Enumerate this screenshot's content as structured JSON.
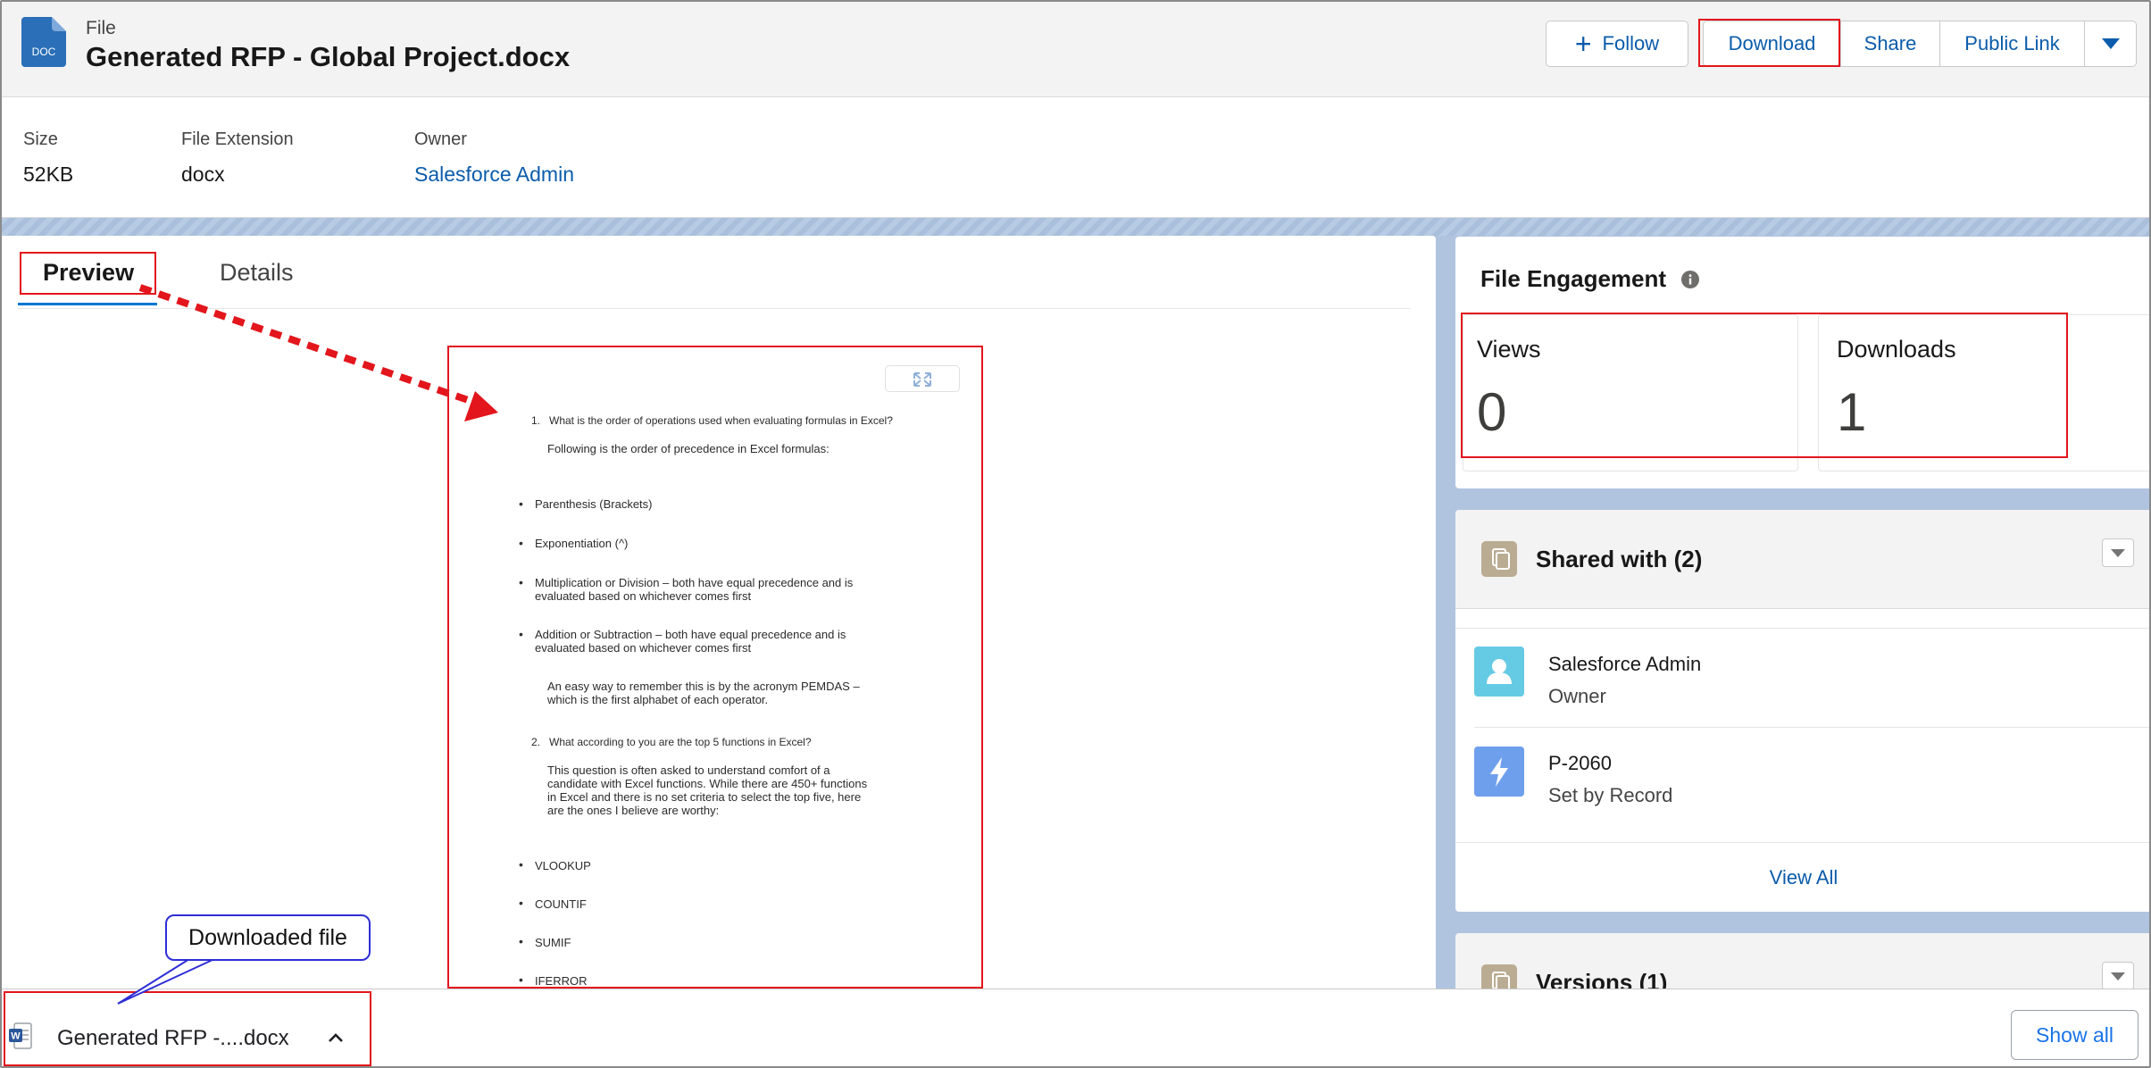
{
  "header": {
    "kind_label": "File",
    "title": "Generated RFP - Global Project.docx",
    "icon_text": "DOC",
    "actions": {
      "follow": "Follow",
      "download": "Download",
      "share": "Share",
      "public_link": "Public Link"
    }
  },
  "meta": {
    "size_label": "Size",
    "size_value": "52KB",
    "ext_label": "File Extension",
    "ext_value": "docx",
    "owner_label": "Owner",
    "owner_value": "Salesforce Admin"
  },
  "tabs": {
    "preview": "Preview",
    "details": "Details"
  },
  "preview_doc": {
    "q1": "1.   What is the order of operations used when evaluating formulas in Excel?",
    "q1_sub": "Following is the order of precedence in Excel formulas:",
    "b1": "Parenthesis (Brackets)",
    "b2": "Exponentiation (^)",
    "b3a": "Multiplication or Division – both have equal precedence and is",
    "b3b": "evaluated based on whichever comes first",
    "b4a": "Addition or Subtraction – both have equal precedence and is",
    "b4b": "evaluated based on whichever comes first",
    "p1a": "An easy way to remember this is by the acronym PEMDAS –",
    "p1b": "which is the first alphabet of each operator.",
    "q2": "2.   What according to you are the top 5 functions in Excel?",
    "p2a": "This question is often asked to understand comfort of a",
    "p2b": "candidate with Excel functions. While there are 450+ functions",
    "p2c": "in Excel and there is no set criteria to select the top five, here",
    "p2d": "are the ones I believe are worthy:",
    "f1": "VLOOKUP",
    "f2": "COUNTIF",
    "f3": "SUMIF",
    "f4": "IFERROR"
  },
  "engagement": {
    "title": "File Engagement",
    "views_label": "Views",
    "views_value": "0",
    "downloads_label": "Downloads",
    "downloads_value": "1"
  },
  "shared": {
    "title": "Shared with (2)",
    "items": [
      {
        "name": "Salesforce Admin",
        "role": "Owner"
      },
      {
        "name": "P-2060",
        "role": "Set by Record"
      }
    ],
    "view_all": "View All"
  },
  "versions": {
    "title": "Versions (1)"
  },
  "download_bar": {
    "file_name": "Generated RFP -....docx",
    "show_all": "Show all"
  },
  "annotation": {
    "callout_text": "Downloaded file"
  },
  "colors": {
    "link_blue": "#0b5cab",
    "highlight_red": "#e2161c",
    "brand_blue": "#0176d3",
    "background_band": "#b0c4df"
  }
}
